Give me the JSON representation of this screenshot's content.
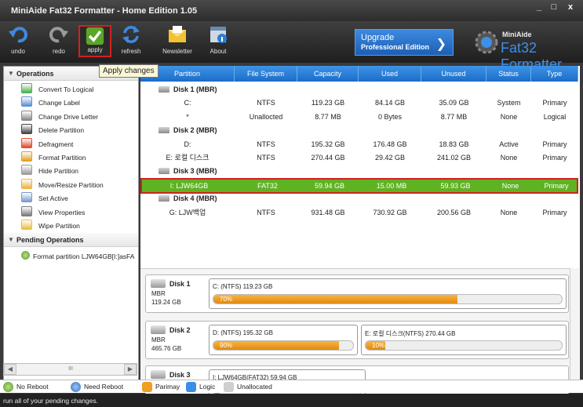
{
  "window": {
    "title": "MiniAide Fat32 Formatter - Home Edition 1.05",
    "min": "_",
    "max": "□",
    "close": "x"
  },
  "toolbar": {
    "undo": "undo",
    "redo": "redo",
    "apply": "apply",
    "refresh": "refresh",
    "newsletter": "Newsletter",
    "about": "About",
    "upgrade_line1": "Upgrade",
    "upgrade_line2": "Professional Edition",
    "brand_small": "MiniAide",
    "brand_large": "Fat32 Formatter"
  },
  "tooltip": "Apply changes",
  "sidebar": {
    "operations_title": "Operations",
    "operations": [
      {
        "label": "Convert To Logical",
        "icon": "convert-icon",
        "color": "#4caf50"
      },
      {
        "label": "Change Label",
        "icon": "label-icon",
        "color": "#5c8fd6"
      },
      {
        "label": "Change Drive Letter",
        "icon": "drive-letter-icon",
        "color": "#888888"
      },
      {
        "label": "Delete Partition",
        "icon": "delete-icon",
        "color": "#444444"
      },
      {
        "label": "Defragment",
        "icon": "defragment-icon",
        "color": "#e04a2a"
      },
      {
        "label": "Format Partition",
        "icon": "format-icon",
        "color": "#e0a020"
      },
      {
        "label": "Hide Partition",
        "icon": "hide-icon",
        "color": "#9a9a9a"
      },
      {
        "label": "Move/Resize Partition",
        "icon": "resize-icon",
        "color": "#f0b040"
      },
      {
        "label": "Set Active",
        "icon": "set-active-icon",
        "color": "#7a9ad0"
      },
      {
        "label": "View Properties",
        "icon": "properties-icon",
        "color": "#7a7a7a"
      },
      {
        "label": "Wipe Partition",
        "icon": "wipe-icon",
        "color": "#e8c040"
      }
    ],
    "pending_title": "Pending Operations",
    "pending": "Format partition LJW64GB[I:]asFA",
    "scroll_thumb": "III"
  },
  "table": {
    "columns": [
      "Partition",
      "File System",
      "Capacity",
      "Used",
      "Unused",
      "Status",
      "Type"
    ],
    "rows": [
      {
        "kind": "disk",
        "name": "Disk 1 (MBR)"
      },
      {
        "kind": "part",
        "cells": [
          "C:",
          "NTFS",
          "119.23 GB",
          "84.14 GB",
          "35.09 GB",
          "System",
          "Primary"
        ]
      },
      {
        "kind": "part",
        "cells": [
          "*",
          "Unallocted",
          "8.77 MB",
          "0 Bytes",
          "8.77 MB",
          "None",
          "Logical"
        ]
      },
      {
        "kind": "disk",
        "name": "Disk 2 (MBR)"
      },
      {
        "kind": "part",
        "cells": [
          "D:",
          "NTFS",
          "195.32 GB",
          "176.48 GB",
          "18.83 GB",
          "Active",
          "Primary"
        ]
      },
      {
        "kind": "part",
        "cells": [
          "E: 로컬 디스크",
          "NTFS",
          "270.44 GB",
          "29.42 GB",
          "241.02 GB",
          "None",
          "Primary"
        ]
      },
      {
        "kind": "disk",
        "name": "Disk 3 (MBR)"
      },
      {
        "kind": "selected",
        "cells": [
          "I: LJW64GB",
          "FAT32",
          "59.94 GB",
          "15.00 MB",
          "59.93 GB",
          "None",
          "Primary"
        ]
      },
      {
        "kind": "disk",
        "name": "Disk 4 (MBR)"
      },
      {
        "kind": "part",
        "cells": [
          "G: LJW백업",
          "NTFS",
          "931.48 GB",
          "730.92 GB",
          "200.56 GB",
          "None",
          "Primary"
        ]
      }
    ]
  },
  "diskmap": [
    {
      "name": "Disk 1",
      "type": "MBR",
      "size": "119.24 GB",
      "partitions": [
        {
          "label": "C: (NTFS) 119.23 GB",
          "percent": 70,
          "percent_label": "70%"
        }
      ]
    },
    {
      "name": "Disk 2",
      "type": "MBR",
      "size": "465.76 GB",
      "partitions": [
        {
          "label": "D: (NTFS) 195.32 GB",
          "percent": 90,
          "percent_label": "90%"
        },
        {
          "label": "E: 로컬 디스크(NTFS) 270.44 GB",
          "percent": 10,
          "percent_label": "10%"
        }
      ]
    },
    {
      "name": "Disk 3",
      "type": "",
      "size": "",
      "partitions": [
        {
          "label": "I: LJW64GB(FAT32) 59.94 GB",
          "percent": 0,
          "percent_label": ""
        }
      ]
    }
  ],
  "legend": {
    "primary": "Parimay",
    "logic": "Logic",
    "unallocated": "Unallocated",
    "no_reboot": "No Reboot",
    "need_reboot": "Need Reboot",
    "primary_color": "#f0a020",
    "logic_color": "#3a8ee6",
    "unallocated_color": "#cfcfcf"
  },
  "status": "run all of your pending changes."
}
